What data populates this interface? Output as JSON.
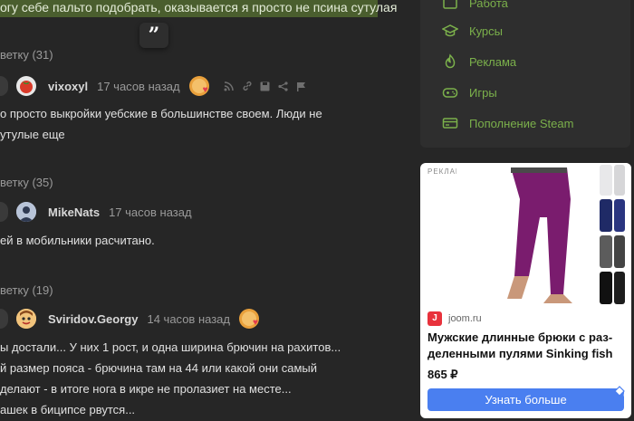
{
  "highlight": {
    "text": "огу себе пальто подобрать, оказывается я просто не псина сутулая"
  },
  "comments": [
    {
      "replies": "ветку (31)",
      "username": "vixoxyl",
      "time": "17 часов назад",
      "has_badge": true,
      "lines": [
        "о просто выкройки уебские в большинстве своем. Люди не",
        "утулые еще"
      ]
    },
    {
      "replies": "ветку (35)",
      "username": "MikeNats",
      "time": "17 часов назад",
      "has_badge": false,
      "lines": [
        "ей в мобильники расчитано."
      ]
    },
    {
      "replies": "ветку (19)",
      "username": "Sviridov.Georgy",
      "time": "14 часов назад",
      "has_badge": true,
      "lines": [
        "ы достали... У них 1 рост, и одна ширина брючин на рахитов...",
        "й размер пояса - брючина там на 44 или какой они самый",
        "делают - в итоге нога в икре не пролазиет на месте...",
        "ашек в биципсе рвутся..."
      ]
    }
  ],
  "sidebar": {
    "menu": [
      {
        "label": "Работа",
        "icon": "briefcase-icon"
      },
      {
        "label": "Курсы",
        "icon": "graduation-cap-icon"
      },
      {
        "label": "Реклама",
        "icon": "flame-icon"
      },
      {
        "label": "Игры",
        "icon": "gamepad-icon"
      },
      {
        "label": "Пополнение Steam",
        "icon": "card-icon"
      }
    ],
    "accent_color": "#7bb04b"
  },
  "ad": {
    "label": "РЕКЛАМА",
    "site": "joom.ru",
    "title": "Мужские длинные брюки с раз­деленными пулями Sinking fish",
    "price": "865 ₽",
    "cta": "Узнать больше",
    "cta_color": "#4a7ff0"
  }
}
